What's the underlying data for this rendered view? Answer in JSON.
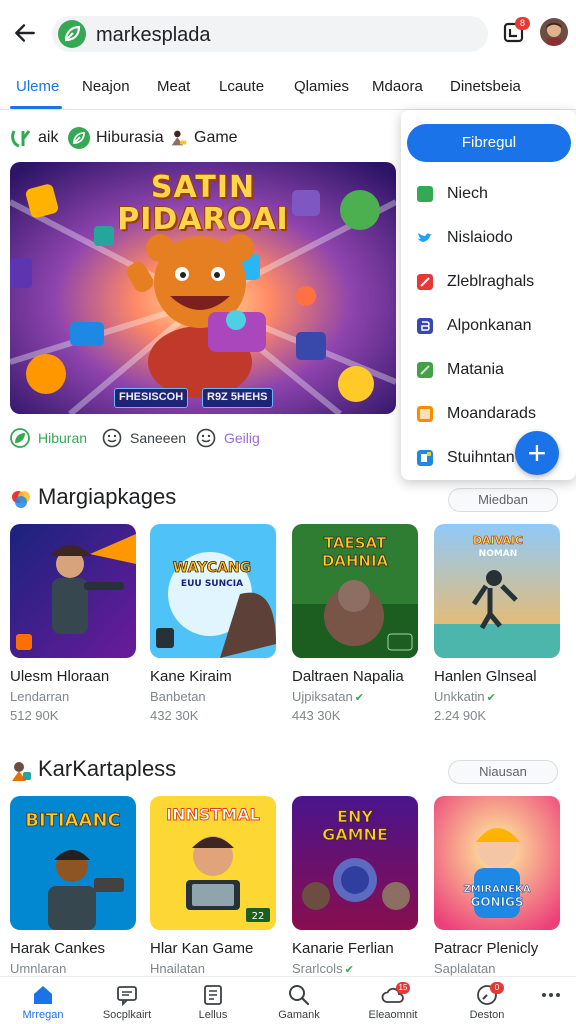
{
  "header": {
    "search_text": "markesplada",
    "notification_badge": "8",
    "back_icon": "arrow-left-icon",
    "logo_icon": "leaf-logo-icon"
  },
  "tabs": [
    {
      "label": "Uleme",
      "active": true
    },
    {
      "label": "Neajon"
    },
    {
      "label": "Meat"
    },
    {
      "label": "Lcaute"
    },
    {
      "label": "Qlamies"
    },
    {
      "label": "Mdaora"
    },
    {
      "label": "Dinetsbeia"
    }
  ],
  "chips": [
    {
      "label": "aik",
      "icon": "brand-mark-icon"
    },
    {
      "label": "Hiburasia",
      "icon": "leaf-icon"
    },
    {
      "label": "Game",
      "icon": "gamer-icon"
    }
  ],
  "hero": {
    "title_line1": "SATIN",
    "title_line2": "PIDAROAI",
    "tag1": "FHESISCOH",
    "tag2": "R9Z 5HEHS"
  },
  "under_hero": [
    {
      "label": "Hiburan",
      "icon": "leaf-icon",
      "color": "#34a853"
    },
    {
      "label": "Saneeen",
      "icon": "smiley-icon",
      "color": "#3c4043"
    },
    {
      "label": "Geilig",
      "icon": "smiley-icon",
      "color": "#9e6ad4"
    }
  ],
  "menu": {
    "button_label": "Fibregul",
    "items": [
      {
        "label": "Niech",
        "color": "#34a853"
      },
      {
        "label": "Nislaiodo",
        "color": "#1da1f2"
      },
      {
        "label": "Zleblraghals",
        "color": "#e53935"
      },
      {
        "label": "Alponkanan",
        "color": "#3949ab"
      },
      {
        "label": "Matania",
        "color": "#43a047"
      },
      {
        "label": "Moandarads",
        "color": "#fb8c00"
      },
      {
        "label": "Stuihntan",
        "color": "#1e88e5"
      }
    ],
    "fab_label": "+"
  },
  "section1": {
    "title": "Margiapkages",
    "more": "Miedban",
    "cards": [
      {
        "title": "Ulesm Hloraan",
        "sub": "Lendarran",
        "meta": "512 90K",
        "verified": false
      },
      {
        "title": "Kane Kiraim",
        "sub": "Banbetan",
        "meta": "432 30K",
        "verified": false,
        "thumb_text": "WAYCANG",
        "thumb_sub": "EUU SUNCIA"
      },
      {
        "title": "Daltraen Napalia",
        "sub": "Ujpiksatan",
        "meta": "443 30K",
        "verified": true,
        "thumb_text": "TAESAT",
        "thumb_sub": "DAHNIA"
      },
      {
        "title": "Hanlen Glnseal",
        "sub": "Unkkatin",
        "meta": "2.24 90K",
        "verified": true,
        "thumb_text": "DAIVAIC",
        "thumb_sub": "NOMAN"
      }
    ]
  },
  "section2": {
    "title": "KarKartapless",
    "more": "Niausan",
    "cards": [
      {
        "title": "Harak Cankes",
        "sub": "Umnlaran",
        "thumb_text": "BITIAANC",
        "verified": false
      },
      {
        "title": "Hlar Kan Game",
        "sub": "Hnailatan",
        "thumb_text": "INNSTMAL",
        "thumb_badge": "22",
        "verified": false
      },
      {
        "title": "Kanarie Ferlian",
        "sub": "Srarlcols",
        "thumb_text": "ENY",
        "thumb_sub": "GAMNE",
        "verified": true
      },
      {
        "title": "Patracr Plenicly",
        "sub": "Saplalatan",
        "thumb_text": "ZMIRANEKA",
        "thumb_sub": "GONIGS",
        "verified": false
      }
    ]
  },
  "bottom_nav": [
    {
      "label": "Mrregan",
      "icon": "home-icon",
      "active": true
    },
    {
      "label": "Socplkairt",
      "icon": "chat-icon"
    },
    {
      "label": "Lellus",
      "icon": "document-icon"
    },
    {
      "label": "Gamank",
      "icon": "search-icon"
    },
    {
      "label": "Eleaomnit",
      "icon": "cloud-icon",
      "badge": "15"
    },
    {
      "label": "Deston",
      "icon": "clock-icon",
      "badge": "0"
    },
    {
      "label": "",
      "icon": "more-icon"
    }
  ],
  "colors": {
    "accent": "#1a73e8",
    "green": "#34a853",
    "badge": "#e53935"
  }
}
